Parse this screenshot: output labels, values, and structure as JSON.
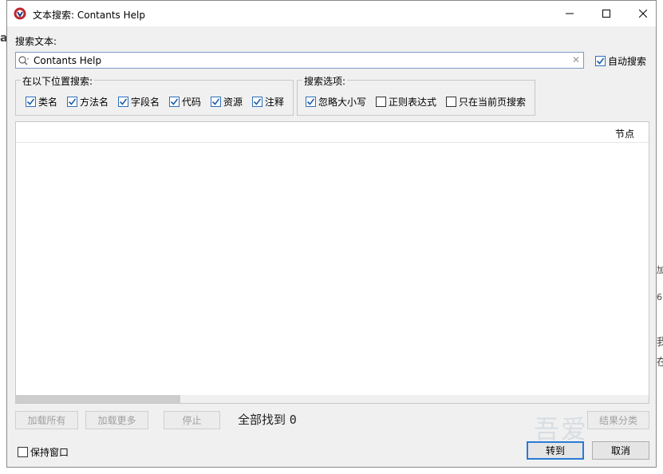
{
  "window": {
    "title": "文本搜索: Contants Help"
  },
  "search": {
    "label": "搜索文本:",
    "value": "Contants Help",
    "auto_search_label": "自动搜索",
    "auto_search_checked": true
  },
  "search_in": {
    "title": "在以下位置搜索:",
    "options": [
      {
        "label": "类名",
        "checked": true
      },
      {
        "label": "方法名",
        "checked": true
      },
      {
        "label": "字段名",
        "checked": true
      },
      {
        "label": "代码",
        "checked": true
      },
      {
        "label": "资源",
        "checked": true
      },
      {
        "label": "注释",
        "checked": true
      }
    ]
  },
  "search_options": {
    "title": "搜索选项:",
    "options": [
      {
        "label": "忽略大小写",
        "checked": true
      },
      {
        "label": "正则表达式",
        "checked": false
      },
      {
        "label": "只在当前页搜索",
        "checked": false
      }
    ]
  },
  "results": {
    "column_node": "节点"
  },
  "footer": {
    "load_all": "加载所有",
    "load_more": "加载更多",
    "stop": "停止",
    "found_label": "全部找到",
    "found_count": "0",
    "group_results": "结果分类",
    "keep_window": "保持窗口",
    "keep_window_checked": false,
    "goto": "转到",
    "cancel": "取消"
  },
  "background": {
    "left_fragment": "a",
    "right_fragments": [
      "加",
      "6",
      "我",
      "在"
    ],
    "watermark": "吾爱"
  },
  "colors": {
    "accent": "#2a7ad6",
    "checkbox_border": "#2e6fb8",
    "disabled_text": "#a0a0a0"
  }
}
